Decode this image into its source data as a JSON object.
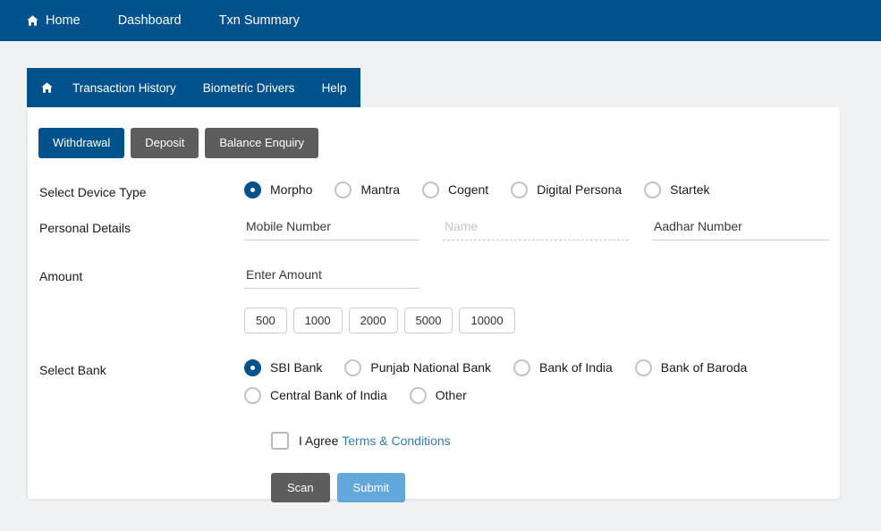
{
  "topnav": {
    "items": [
      {
        "label": "Home",
        "icon": "home-icon"
      },
      {
        "label": "Dashboard",
        "icon": ""
      },
      {
        "label": "Txn Summary",
        "icon": ""
      }
    ]
  },
  "subnav": {
    "home_icon": "home-icon",
    "items": [
      {
        "label": "Transaction History"
      },
      {
        "label": "Biometric Drivers"
      },
      {
        "label": "Help"
      }
    ]
  },
  "tabs": [
    {
      "label": "Withdrawal",
      "active": true
    },
    {
      "label": "Deposit",
      "active": false
    },
    {
      "label": "Balance Enquiry",
      "active": false
    }
  ],
  "device_type": {
    "label": "Select Device Type",
    "options": [
      {
        "label": "Morpho",
        "selected": true
      },
      {
        "label": "Mantra",
        "selected": false
      },
      {
        "label": "Cogent",
        "selected": false
      },
      {
        "label": "Digital Persona",
        "selected": false
      },
      {
        "label": "Startek",
        "selected": false
      }
    ]
  },
  "personal_details": {
    "label": "Personal Details",
    "mobile": {
      "placeholder": "Mobile Number",
      "value": "",
      "disabled": false
    },
    "name": {
      "placeholder": "Name",
      "value": "",
      "disabled": true
    },
    "aadhar": {
      "placeholder": "Aadhar Number",
      "value": "",
      "disabled": false
    }
  },
  "amount": {
    "label": "Amount",
    "input": {
      "placeholder": "Enter Amount",
      "value": ""
    },
    "quick_values": [
      "500",
      "1000",
      "2000",
      "5000",
      "10000"
    ]
  },
  "bank": {
    "label": "Select Bank",
    "options": [
      {
        "label": "SBI Bank",
        "selected": true
      },
      {
        "label": "Punjab National Bank",
        "selected": false
      },
      {
        "label": "Bank of India",
        "selected": false
      },
      {
        "label": "Bank of Baroda",
        "selected": false
      },
      {
        "label": "Central Bank of India",
        "selected": false
      },
      {
        "label": "Other",
        "selected": false
      }
    ]
  },
  "agreement": {
    "checked": false,
    "text": "I Agree",
    "link_text": "Terms & Conditions"
  },
  "actions": {
    "scan_label": "Scan",
    "submit_label": "Submit"
  },
  "colors": {
    "nav_blue": "#00528d",
    "tab_gray": "#5d5d5d",
    "submit_blue": "#62a8db",
    "link_blue": "#337ab7",
    "page_bg": "#f0f1f3"
  }
}
